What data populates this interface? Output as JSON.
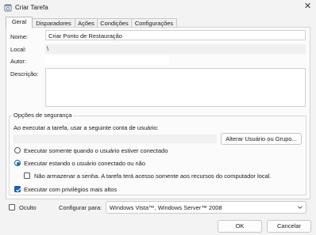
{
  "window": {
    "title": "Criar Tarefa"
  },
  "tabs": [
    {
      "label": "Geral"
    },
    {
      "label": "Disparadores"
    },
    {
      "label": "Ações"
    },
    {
      "label": "Condições"
    },
    {
      "label": "Configurações"
    }
  ],
  "general": {
    "name_label": "Nome:",
    "name_value": "Criar Ponto de Restauração",
    "location_label": "Local:",
    "location_value": "\\",
    "author_label": "Autor:",
    "author_value": "",
    "description_label": "Descrição:",
    "description_value": ""
  },
  "security": {
    "group_title": "Opções de segurança",
    "run_as_text": "Ao executar a tarefa, usar a seguinte conta de usuário:",
    "account_value": "",
    "change_user_button": "Alterar Usuário ou Grupo...",
    "option_logged_on": "Executar somente quando o usuário estiver conectado",
    "option_logged_or_not": "Executar estando o usuário conectado ou não",
    "no_store_password": "Não armazenar a senha. A tarefa terá acesso somente aos recursos do computador local.",
    "highest_privileges": "Executar com privilégios mais altos"
  },
  "footer": {
    "hidden_label": "Oculto",
    "configure_for_label": "Configurar para:",
    "configure_for_value": "Windows Vista™, Windows Server™ 2008",
    "ok_button": "OK",
    "cancel_button": "Cancelar"
  },
  "state": {
    "selected_tab": "Geral",
    "run_option": "logged_or_not",
    "no_store_password_checked": false,
    "highest_privileges_checked": true,
    "hidden_checked": false
  },
  "colors": {
    "accent": "#1a5fb4"
  }
}
